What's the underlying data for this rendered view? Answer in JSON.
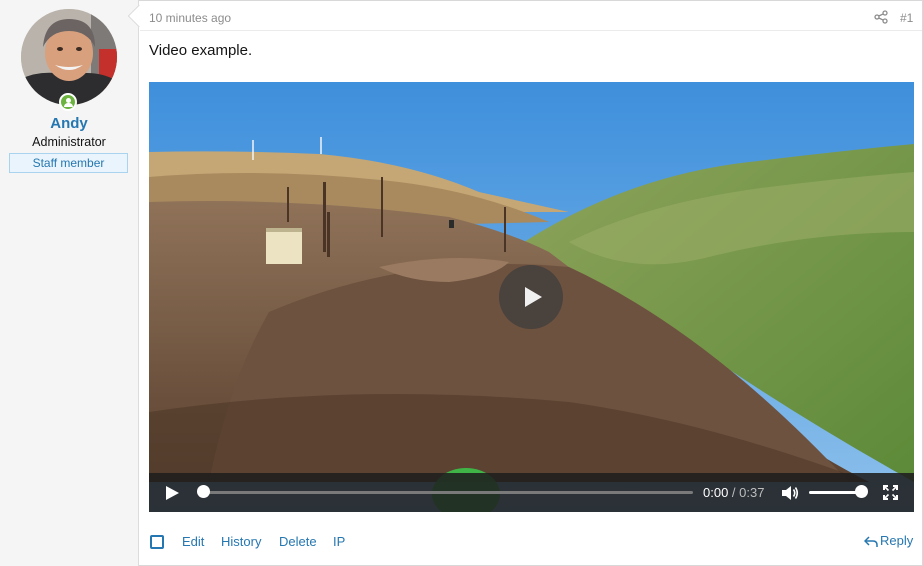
{
  "user": {
    "name": "Andy",
    "title": "Administrator",
    "badge": "Staff member"
  },
  "post": {
    "time": "10 minutes ago",
    "number": "#1",
    "text": "Video example."
  },
  "video": {
    "current_time": "0:00",
    "separator": " / ",
    "duration": "0:37",
    "progress": 0.0,
    "volume": 1.0
  },
  "actions": {
    "edit": "Edit",
    "history": "History",
    "delete": "Delete",
    "ip": "IP",
    "reply": "Reply"
  },
  "colors": {
    "link": "#2577b1",
    "online": "#6cb33f",
    "badge_bg": "#e9f4fc"
  },
  "icons": [
    "share-icon",
    "online-status-icon",
    "play-icon",
    "volume-icon",
    "fullscreen-icon",
    "reply-icon",
    "select-checkbox"
  ]
}
